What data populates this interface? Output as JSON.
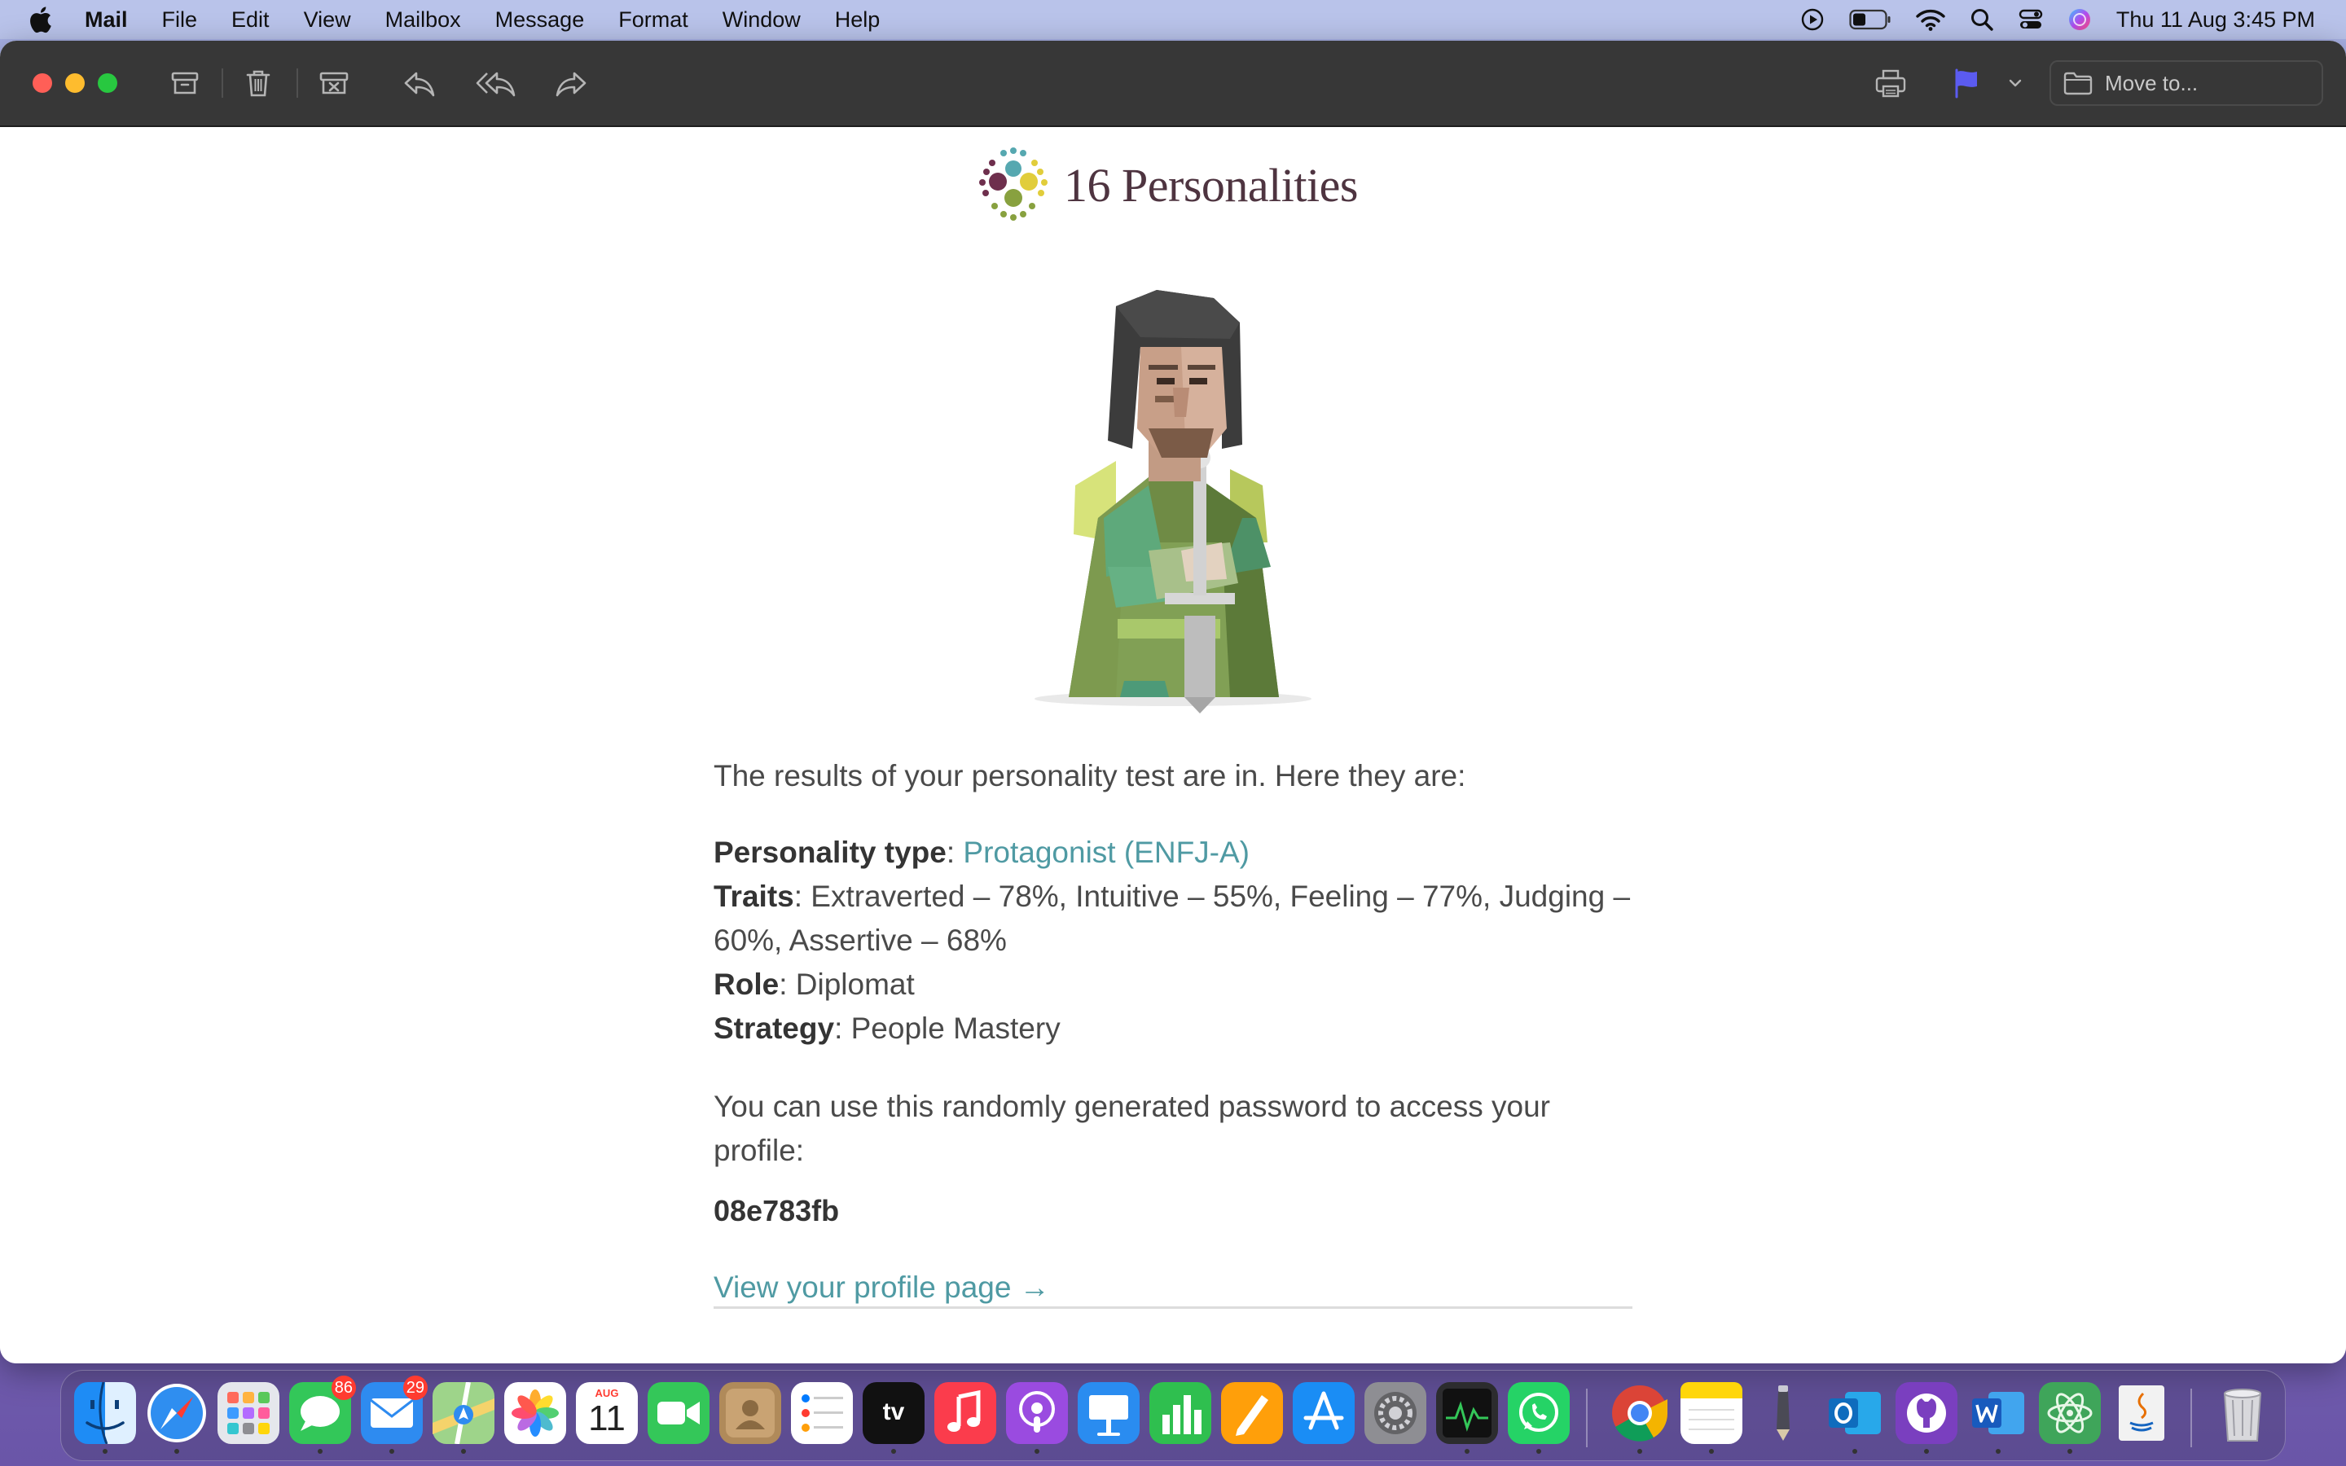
{
  "menubar": {
    "app_name": "Mail",
    "menus": [
      "File",
      "Edit",
      "View",
      "Mailbox",
      "Message",
      "Format",
      "Window",
      "Help"
    ],
    "clock": "Thu 11 Aug  3:45 PM",
    "status_icons": [
      "play-circle-icon",
      "battery-icon",
      "wifi-icon",
      "spotlight-search-icon",
      "control-center-icon",
      "siri-icon"
    ]
  },
  "toolbar": {
    "buttons": [
      "archive-icon",
      "trash-icon",
      "junk-icon",
      "reply-icon",
      "reply-all-icon",
      "forward-icon",
      "print-icon",
      "flag-icon"
    ],
    "flag_color": "#5b5bf0",
    "move_to_label": "Move to..."
  },
  "email": {
    "logo_text": "16 Personalities",
    "intro": "The results of your personality test are in. Here they are:",
    "type_label": "Personality type",
    "type_value": "Protagonist (ENFJ-A)",
    "traits_label": "Traits",
    "traits_value": "Extraverted – 78%, Intuitive – 55%, Feeling – 77%, Judging – 60%, Assertive – 68%",
    "role_label": "Role",
    "role_value": "Diplomat",
    "strategy_label": "Strategy",
    "strategy_value": "People Mastery",
    "password_intro": "You can use this randomly generated password to access your profile:",
    "password": "08e783fb",
    "profile_link": "View your profile page →",
    "accent_color": "#4f9aa3"
  },
  "dock": {
    "apps": [
      {
        "name": "Finder"
      },
      {
        "name": "Safari"
      },
      {
        "name": "Launchpad"
      },
      {
        "name": "Messages",
        "badge": "86"
      },
      {
        "name": "Mail",
        "badge": "29"
      },
      {
        "name": "Maps"
      },
      {
        "name": "Photos"
      },
      {
        "name": "Calendar",
        "month": "AUG",
        "day": "11"
      },
      {
        "name": "FaceTime"
      },
      {
        "name": "Contacts"
      },
      {
        "name": "Reminders"
      },
      {
        "name": "TV",
        "label": "tv"
      },
      {
        "name": "Music"
      },
      {
        "name": "Podcasts"
      },
      {
        "name": "Keynote"
      },
      {
        "name": "Numbers"
      },
      {
        "name": "Pages"
      },
      {
        "name": "App Store"
      },
      {
        "name": "System Preferences"
      },
      {
        "name": "Activity Monitor"
      },
      {
        "name": "WhatsApp"
      },
      {
        "name": "Chrome"
      },
      {
        "name": "Notes"
      },
      {
        "name": "Pen"
      },
      {
        "name": "Outlook"
      },
      {
        "name": "GitHub Desktop"
      },
      {
        "name": "Word"
      },
      {
        "name": "Atom"
      },
      {
        "name": "Java"
      },
      {
        "name": "Trash"
      }
    ]
  }
}
